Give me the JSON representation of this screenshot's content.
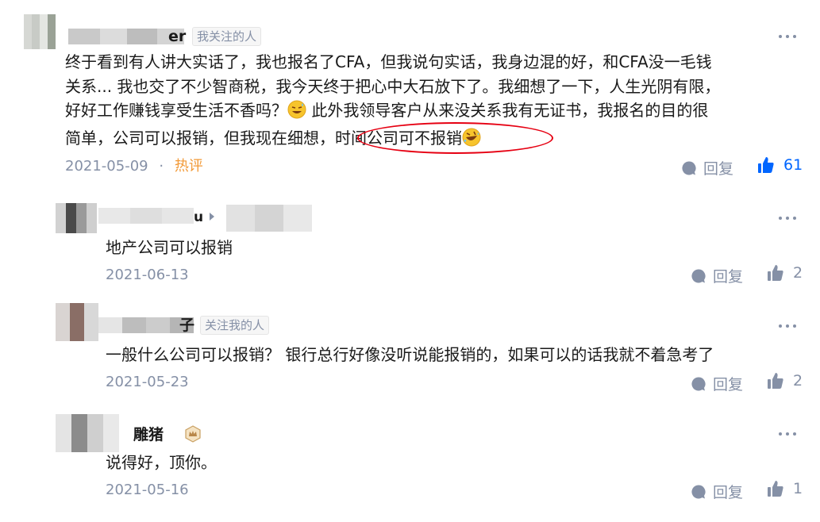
{
  "comments": [
    {
      "author_tail": "er",
      "tag": "我关注的人",
      "lines": [
        "终于看到有人讲大实话了，我也报名了CFA，但我说句实话，我身边混的好，和CFA没一毛钱",
        "关系... 我也交了不少智商税，我今天终于把心中大石放下了。我细想了一下，人生光阴有限，",
        "好好工作赚钱享受生活不香吗？",
        " 此外我领导客户从来没关系我有无证书，我报名的目的很",
        "简单，公司可以报销，但我现在细想，",
        "时间公司可不报销"
      ],
      "date": "2021-05-09",
      "dot": "·",
      "hot": "热评",
      "reply_label": "回复",
      "likes": "61"
    },
    {
      "author_tail": "u",
      "text": "地产公司可以报销",
      "date": "2021-06-13",
      "reply_label": "回复",
      "likes": "2"
    },
    {
      "author_tail": "子",
      "tag": "关注我的人",
      "text": "一般什么公司可以报销？ 银行总行好像没听说能报销的，如果可以的话我就不着急考了",
      "date": "2021-05-23",
      "reply_label": "回复",
      "likes": "2"
    },
    {
      "author_tail": "雕猪",
      "text": "说得好，顶你。",
      "date": "2021-05-16",
      "reply_label": "回复",
      "likes": "1"
    }
  ],
  "colors": {
    "accent": "#0066ff",
    "meta_gray": "#8590a6",
    "hot": "#f29a38",
    "highlight": "#e60012"
  }
}
